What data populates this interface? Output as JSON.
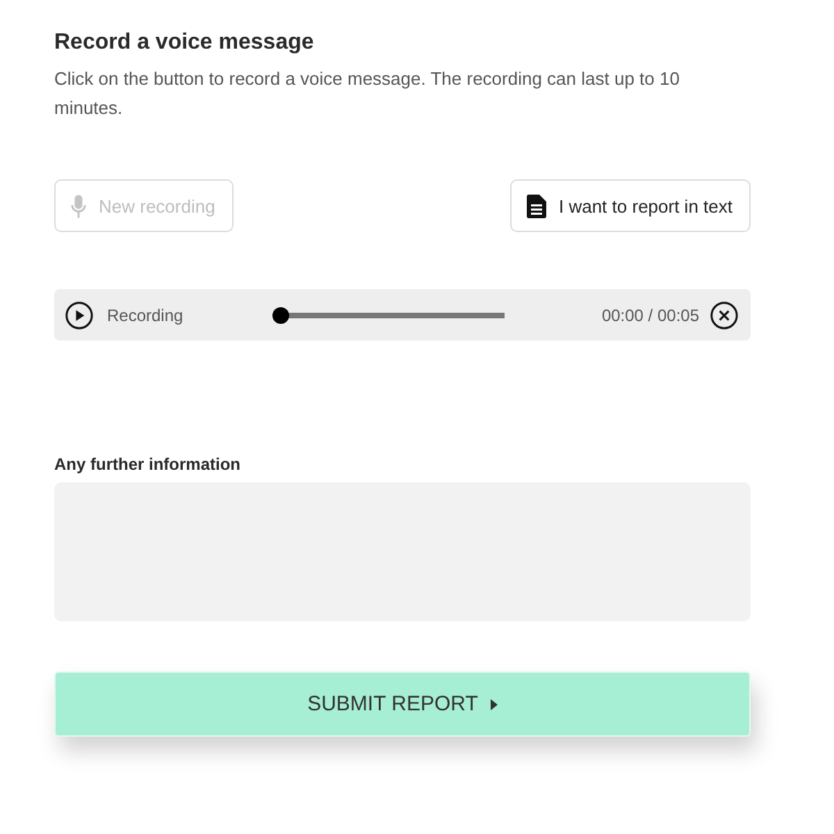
{
  "title": "Record a voice message",
  "description": "Click on the button to record a voice message. The recording can last up to 10 minutes.",
  "buttons": [
    {
      "kind": "record",
      "label": "New recording",
      "disabled": true
    },
    {
      "kind": "text",
      "label": "I want to report in text",
      "disabled": false
    }
  ],
  "player": {
    "label": "Recording",
    "level": 0,
    "time": "00:00 / 00:05"
  },
  "further_info": {
    "label": "Any further information"
  },
  "submit": {
    "label": "SUBMIT REPORT"
  }
}
